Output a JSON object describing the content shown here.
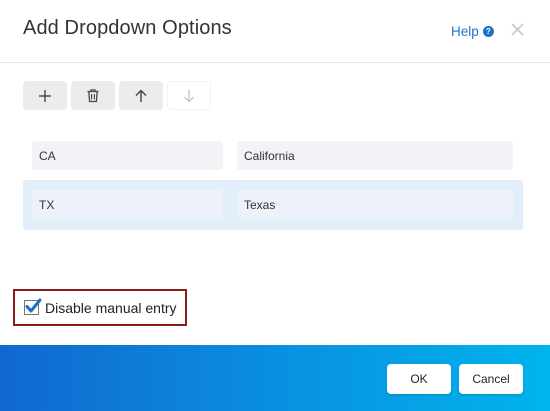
{
  "dialog": {
    "title": "Add Dropdown Options",
    "help_label": "Help",
    "help_icon": "question-circle-icon",
    "close_icon": "close-x-icon"
  },
  "toolbar": {
    "buttons": [
      {
        "name": "add",
        "icon": "plus-icon",
        "enabled": true
      },
      {
        "name": "delete",
        "icon": "trash-icon",
        "enabled": true
      },
      {
        "name": "move-up",
        "icon": "arrow-up-icon",
        "enabled": true
      },
      {
        "name": "move-down",
        "icon": "arrow-down-icon",
        "enabled": false
      }
    ]
  },
  "options": [
    {
      "code": "CA",
      "label": "California",
      "selected": false
    },
    {
      "code": "TX",
      "label": "Texas",
      "selected": true
    }
  ],
  "disable_manual_entry": {
    "label": "Disable manual entry",
    "checked": true
  },
  "footer": {
    "ok_label": "OK",
    "cancel_label": "Cancel"
  },
  "colors": {
    "accent": "#1a73c8",
    "selected_row": "#e3eefb",
    "highlight_border": "#8b1a1a"
  }
}
